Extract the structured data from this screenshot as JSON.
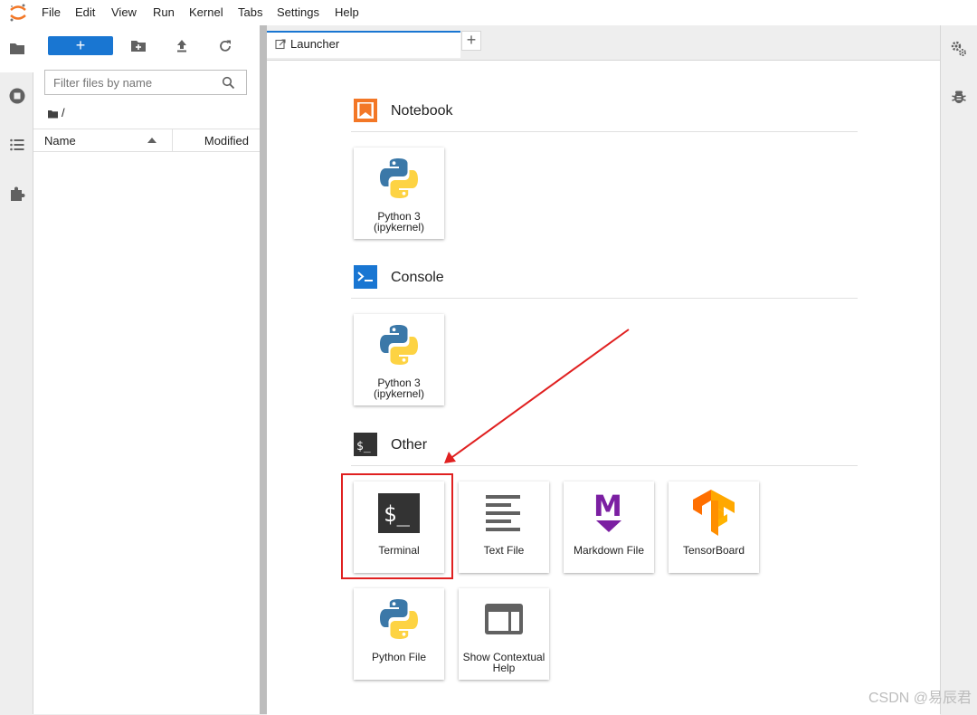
{
  "menubar": {
    "items": [
      "File",
      "Edit",
      "View",
      "Run",
      "Kernel",
      "Tabs",
      "Settings",
      "Help"
    ]
  },
  "left_sidebar": {
    "icons": [
      "folder-icon",
      "running-icon",
      "toc-icon",
      "extension-icon"
    ]
  },
  "file_browser": {
    "new_label": "+",
    "toolbar_icons": [
      "new-folder-icon",
      "upload-icon",
      "refresh-icon"
    ],
    "filter_placeholder": "Filter files by name",
    "breadcrumb": "/",
    "columns": {
      "name": "Name",
      "modified": "Modified"
    }
  },
  "tabs": {
    "active_label": "Launcher",
    "add_label": "+"
  },
  "launcher": {
    "sections": [
      {
        "title": "Notebook",
        "icon": "notebook-icon",
        "cards": [
          {
            "label_lines": [
              "Python 3",
              "(ipykernel)"
            ],
            "icon": "python-icon"
          }
        ]
      },
      {
        "title": "Console",
        "icon": "console-icon",
        "cards": [
          {
            "label_lines": [
              "Python 3",
              "(ipykernel)"
            ],
            "icon": "python-icon"
          }
        ]
      },
      {
        "title": "Other",
        "icon": "terminal-icon",
        "cards": [
          {
            "label_lines": [
              "Terminal"
            ],
            "icon": "terminal-icon"
          },
          {
            "label_lines": [
              "Text File"
            ],
            "icon": "text-file-icon"
          },
          {
            "label_lines": [
              "Markdown File"
            ],
            "icon": "markdown-icon"
          },
          {
            "label_lines": [
              "TensorBoard"
            ],
            "icon": "tensorboard-icon"
          },
          {
            "label_lines": [
              "Python File"
            ],
            "icon": "python-icon"
          },
          {
            "label_lines": [
              "Show Contextual",
              "Help"
            ],
            "icon": "contextual-help-icon"
          }
        ]
      }
    ]
  },
  "right_sidebar": {
    "icons": [
      "property-inspector-icon",
      "debugger-icon"
    ]
  },
  "annotation": {
    "highlight_color": "#e02020"
  },
  "colors": {
    "accent": "#1976d2",
    "notebook_orange": "#f37726",
    "markdown_purple": "#7b1fa2"
  },
  "watermark": "CSDN @易辰君"
}
